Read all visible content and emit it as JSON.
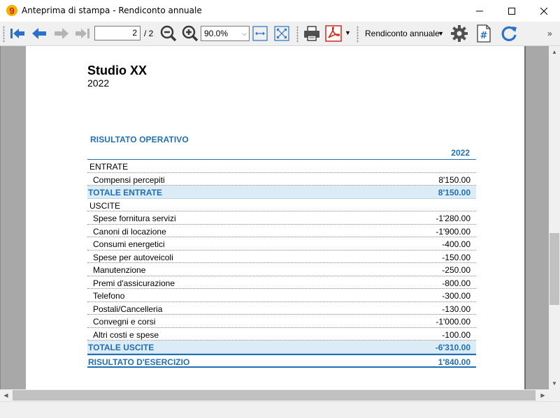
{
  "window": {
    "title": "Anteprima di stampa - Rendiconto annuale",
    "app_icon": "banana-9-icon"
  },
  "toolbar": {
    "page_current": "2",
    "page_total": "/ 2",
    "zoom": "90.0%",
    "report": "Rendiconto annuale",
    "overflow": "»",
    "icons": [
      "first-page-icon",
      "prev-page-icon",
      "next-page-icon",
      "last-page-icon",
      "zoom-out-icon",
      "zoom-in-icon",
      "fit-width-icon",
      "fit-page-icon",
      "print-icon",
      "pdf-icon",
      "settings-icon",
      "page-number-icon",
      "refresh-icon"
    ]
  },
  "report": {
    "company": "Studio XX",
    "year": "2022",
    "section_title": "RISULTATO OPERATIVO",
    "column_header": "2022",
    "rows": [
      {
        "kind": "group",
        "label": "ENTRATE",
        "amount": ""
      },
      {
        "kind": "item",
        "label": "Compensi percepiti",
        "amount": "8'150.00"
      },
      {
        "kind": "total",
        "label": "TOTALE ENTRATE",
        "amount": "8'150.00"
      },
      {
        "kind": "group",
        "label": "USCITE",
        "amount": ""
      },
      {
        "kind": "item",
        "label": "Spese fornitura servizi",
        "amount": "-1'280.00"
      },
      {
        "kind": "item",
        "label": "Canoni di locazione",
        "amount": "-1'900.00"
      },
      {
        "kind": "item",
        "label": "Consumi energetici",
        "amount": "-400.00"
      },
      {
        "kind": "item",
        "label": "Spese per autoveicoli",
        "amount": "-150.00"
      },
      {
        "kind": "item",
        "label": "Manutenzione",
        "amount": "-250.00"
      },
      {
        "kind": "item",
        "label": "Premi d'assicurazione",
        "amount": "-800.00"
      },
      {
        "kind": "item",
        "label": "Telefono",
        "amount": "-300.00"
      },
      {
        "kind": "item",
        "label": "Postali/Cancelleria",
        "amount": "-130.00"
      },
      {
        "kind": "item",
        "label": "Convegni e corsi",
        "amount": "-1'000.00"
      },
      {
        "kind": "item",
        "label": "Altri costi e spese",
        "amount": "-100.00"
      },
      {
        "kind": "total",
        "label": "TOTALE USCITE",
        "amount": "-6'310.00"
      },
      {
        "kind": "final",
        "label": "RISULTATO D'ESERCIZIO",
        "amount": "1'840.00"
      }
    ]
  },
  "colors": {
    "accent_blue": "#1f6fb4",
    "total_row_bg": "#dcecf7",
    "nav_arrow_blue": "#2a72c9",
    "pdf_red": "#d0281c"
  }
}
